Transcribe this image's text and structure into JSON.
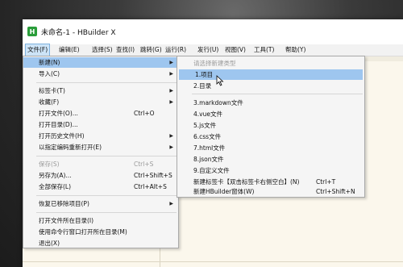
{
  "window": {
    "title": "未命名-1 - HBuilder X",
    "icon_letter": "H",
    "icon_color": "#2a9d3a"
  },
  "menubar": [
    "文件(F)",
    "编辑(E)",
    "选择(S)",
    "查找(I)",
    "跳转(G)",
    "运行(R)",
    "发行(U)",
    "视图(V)",
    "工具(T)",
    "帮助(Y)"
  ],
  "file_menu": {
    "items": [
      {
        "label": "新建(N)",
        "shortcut": "",
        "submenu": true
      },
      {
        "label": "导入(C)",
        "shortcut": "",
        "submenu": true
      },
      {
        "label": "标签卡(T)",
        "shortcut": "",
        "submenu": true
      },
      {
        "label": "收藏(F)",
        "shortcut": "",
        "submenu": true
      },
      {
        "label": "打开文件(O)...",
        "shortcut": "Ctrl+O"
      },
      {
        "label": "打开目录(D)...",
        "shortcut": ""
      },
      {
        "label": "打开历史文件(H)",
        "shortcut": "",
        "submenu": true
      },
      {
        "label": "以指定编码重新打开(E)",
        "shortcut": "",
        "submenu": true
      },
      {
        "label": "保存(S)",
        "shortcut": "Ctrl+S",
        "disabled": true
      },
      {
        "label": "另存为(A)...",
        "shortcut": "Ctrl+Shift+S"
      },
      {
        "label": "全部保存(L)",
        "shortcut": "Ctrl+Alt+S"
      },
      {
        "label": "恢复已移除项目(P)",
        "shortcut": "",
        "submenu": true
      },
      {
        "label": "打开文件所在目录(I)",
        "shortcut": ""
      },
      {
        "label": "使用命令行窗口打开所在目录(M)",
        "shortcut": ""
      },
      {
        "label": "退出(X)",
        "shortcut": ""
      }
    ]
  },
  "new_submenu": {
    "header": "请选择新建类型",
    "items": [
      {
        "label": "1.项目",
        "shortcut": ""
      },
      {
        "label": "2.目录",
        "shortcut": ""
      },
      {
        "label": "3.markdown文件",
        "shortcut": ""
      },
      {
        "label": "4.vue文件",
        "shortcut": ""
      },
      {
        "label": "5.js文件",
        "shortcut": ""
      },
      {
        "label": "6.css文件",
        "shortcut": ""
      },
      {
        "label": "7.html文件",
        "shortcut": ""
      },
      {
        "label": "8.json文件",
        "shortcut": ""
      },
      {
        "label": "9.自定义文件",
        "shortcut": ""
      },
      {
        "label": "新建标签卡【双击标签卡右侧空白】(N)",
        "shortcut": "Ctrl+T"
      },
      {
        "label": "新建HBuilder窗体(W)",
        "shortcut": "Ctrl+Shift+N"
      }
    ]
  },
  "colors": {
    "highlight": "#9ec6ef",
    "editor_bg": "#fbf7ec",
    "menu_bg": "#f5f5f5"
  }
}
